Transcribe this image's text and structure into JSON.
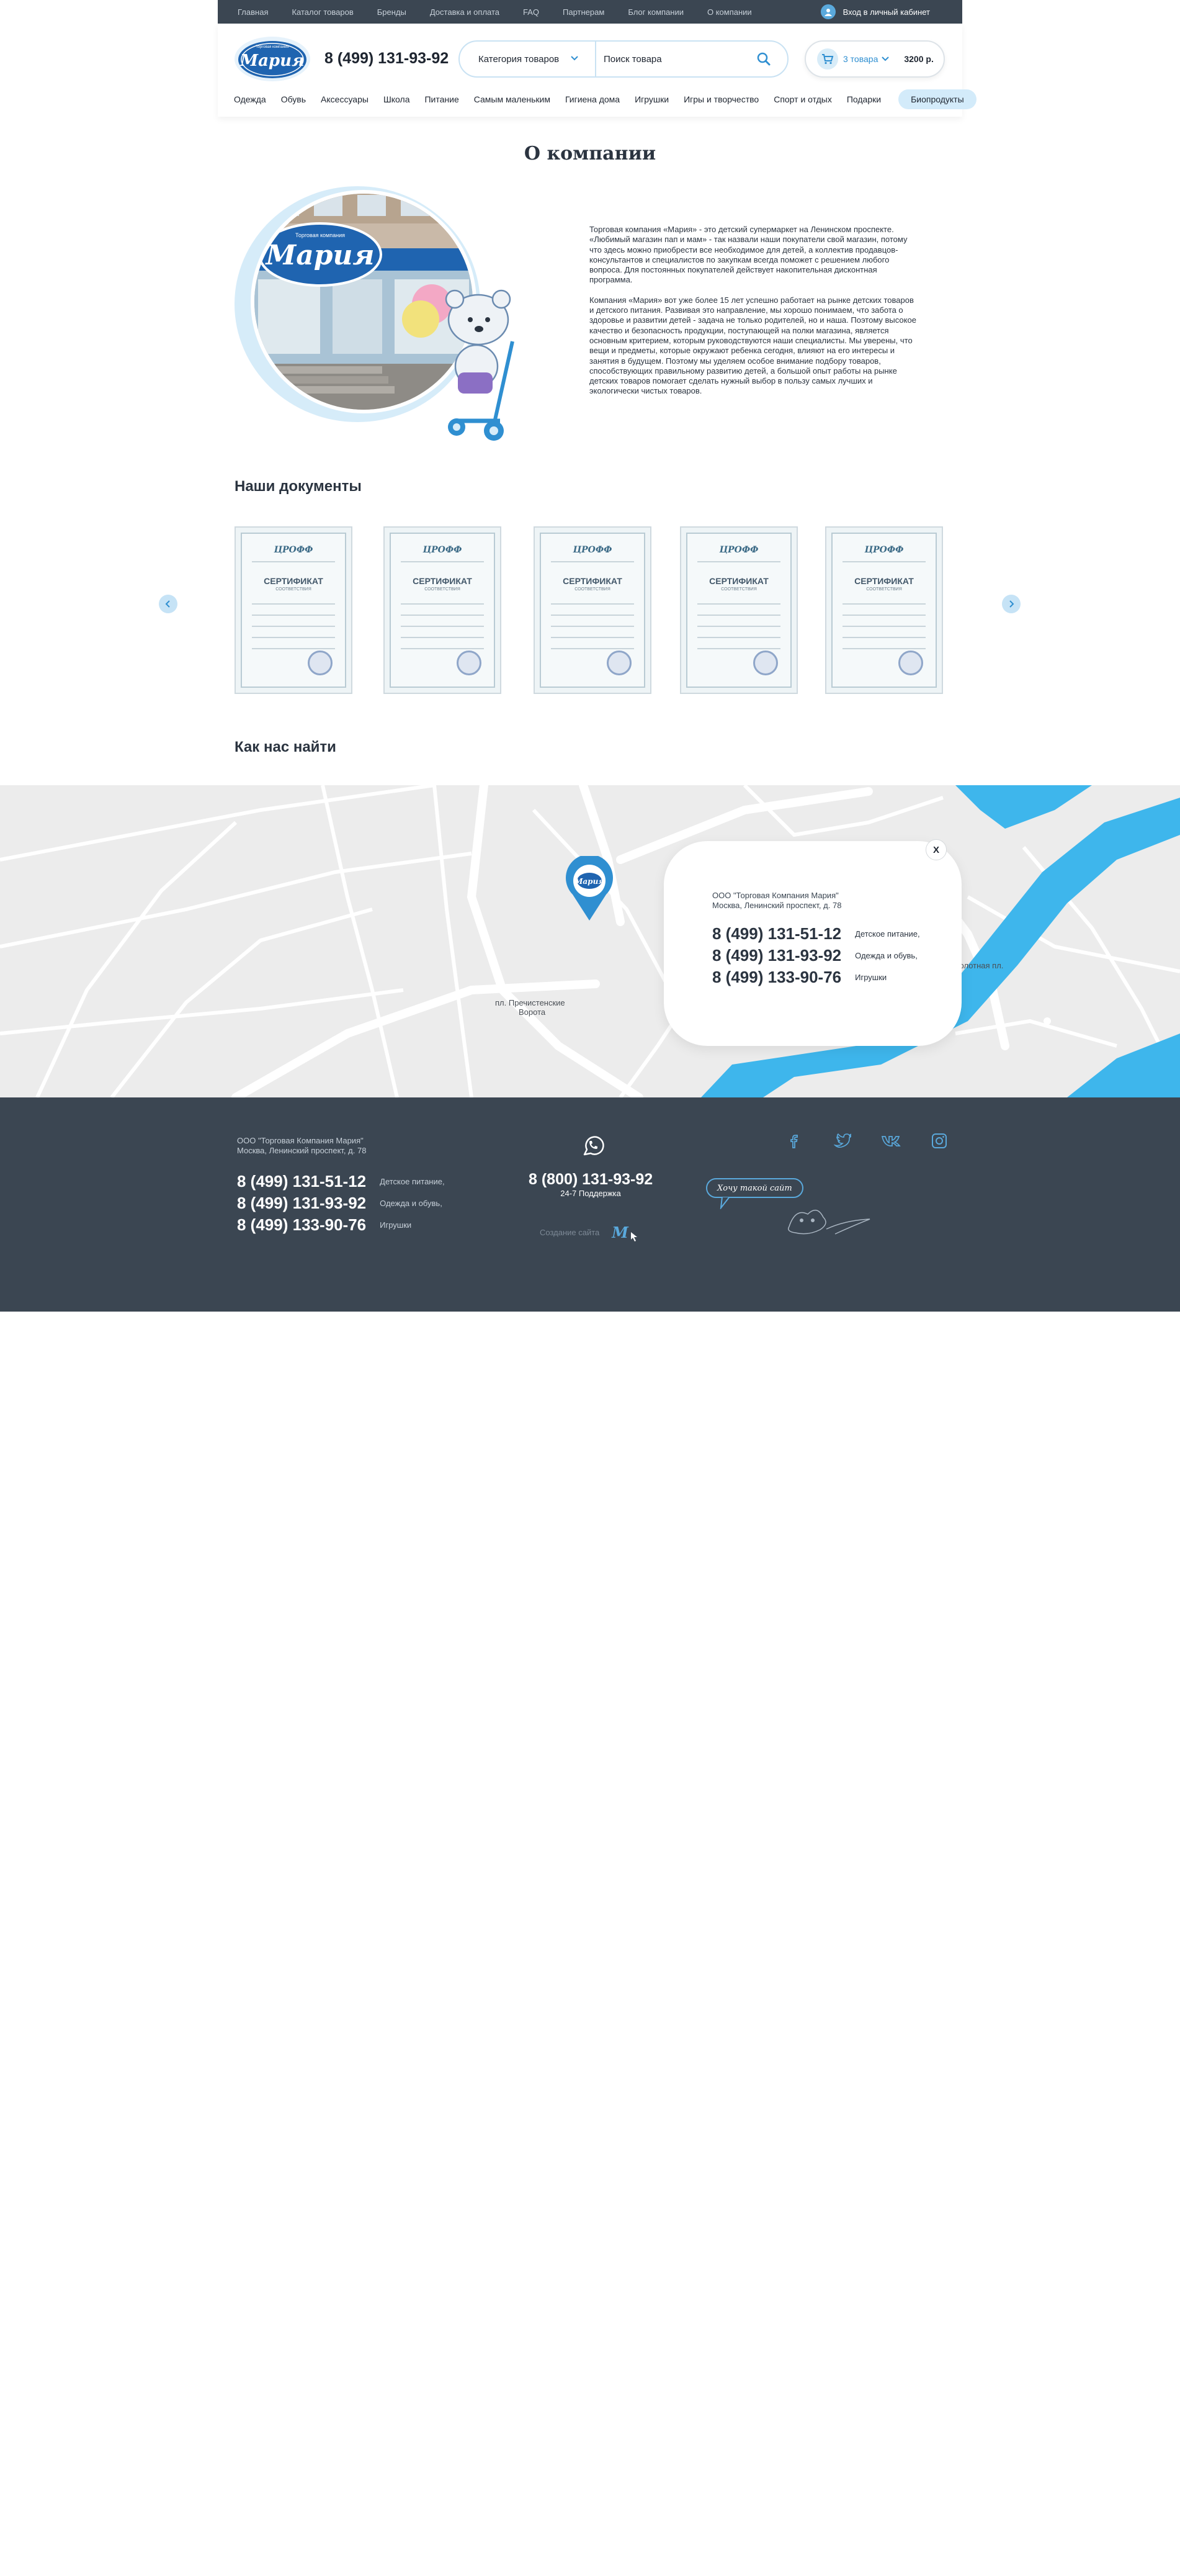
{
  "topbar": {
    "nav": [
      "Главная",
      "Каталог товаров",
      "Бренды",
      "Доставка и оплата",
      "FAQ",
      "Партнерам",
      "Блог компании",
      "О компании"
    ],
    "login_label": "Вход в личный кабинет"
  },
  "header": {
    "logo_text": "Мария",
    "logo_tagline": "Торговая компания",
    "phone": "8 (499) 131-93-92",
    "category_label": "Категория  товаров",
    "search_placeholder": "Поиск товара",
    "cart_count": "3 товара",
    "cart_total": "3200 р.",
    "categories": [
      "Одежда",
      "Обувь",
      "Аксессуары",
      "Школа",
      "Питание",
      "Самым маленьким",
      "Гигиена дома",
      "Игрушки",
      "Игры и творчество",
      "Спорт и отдых",
      "Подарки"
    ],
    "bio_label": "Биопродукты"
  },
  "about": {
    "title": "О компании",
    "store_sign": "Мария",
    "store_sign_top": "Торговая компания",
    "paragraphs": [
      "Торговая компания «Мария» - это детский супермаркет на Ленинском проспекте. «Любимый магазин пап и мам» - так назвали наши покупатели свой магазин, потому что здесь можно приобрести все необходимое для детей, а коллектив продавцов-консультантов и специалистов по закупкам всегда поможет с решением любого вопроса. Для постоянных покупателей действует накопительная дисконтная программа.",
      "Компания «Мария» вот уже более 15 лет успешно работает на рынке детских товаров и детского питания. Развивая это направление, мы хорошо понимаем, что забота о здоровье и развитии детей - задача не только родителей, но и наша. Поэтому высокое качество и безопасность продукции, поступающей на полки магазина, является основным критерием, которым руководствуются наши специалисты. Мы уверены, что вещи и предметы, которые окружают ребенка сегодня, влияют на его интересы и занятия в будущем. Поэтому мы уделяем особое внимание подбору товаров, способствующих правильному развитию детей, а большой опыт работы на рынке детских товаров помогает сделать нужный выбор в пользу самых лучших и экологически чистых товаров."
    ]
  },
  "documents": {
    "title": "Наши документы",
    "items": [
      {
        "org": "ЦРОФФ",
        "title": "СЕРТИФИКАТ",
        "subtitle": "СООТВЕТСТВИЯ"
      },
      {
        "org": "ЦРОФФ",
        "title": "СЕРТИФИКАТ",
        "subtitle": "СООТВЕТСТВИЯ"
      },
      {
        "org": "ЦРОФФ",
        "title": "СЕРТИФИКАТ",
        "subtitle": "СООТВЕТСТВИЯ"
      },
      {
        "org": "ЦРОФФ",
        "title": "СЕРТИФИКАТ",
        "subtitle": "СООТВЕТСТВИЯ"
      },
      {
        "org": "ЦРОФФ",
        "title": "СЕРТИФИКАТ",
        "subtitle": "СООТВЕТСТВИЯ"
      }
    ]
  },
  "find_us": {
    "title": "Как нас найти",
    "map_labels": [
      "пл. Пречистенские",
      "Ворота",
      "Болотная пл."
    ],
    "card": {
      "company": "ООО \"Торговая Компания Мария\"",
      "address": "Москва, Ленинский проспект, д. 78",
      "phones": [
        {
          "number": "8 (499) 131-51-12",
          "desc": "Детское питание,"
        },
        {
          "number": "8 (499) 131-93-92",
          "desc": "Одежда и обувь,"
        },
        {
          "number": "8 (499) 133-90-76",
          "desc": "Игрушки"
        }
      ],
      "close_label": "X"
    }
  },
  "footer": {
    "company": "ООО \"Торговая Компания Мария\"",
    "address": "Москва, Ленинский проспект, д. 78",
    "phones": [
      {
        "number": "8 (499) 131-51-12",
        "desc": "Детское питание,"
      },
      {
        "number": "8 (499) 131-93-92",
        "desc": "Одежда и обувь,"
      },
      {
        "number": "8 (499) 133-90-76",
        "desc": "Игрушки"
      }
    ],
    "support_phone": "8 (800) 131-93-92",
    "support_label": "24-7 Поддержка",
    "made_by_label": "Создание сайта",
    "made_by_logo": "M",
    "want_site_label": "Хочу такой сайт",
    "socials": [
      "facebook-icon",
      "twitter-icon",
      "vk-icon",
      "instagram-icon"
    ]
  },
  "colors": {
    "accent": "#2f8fd1",
    "dark": "#3b4652",
    "water": "#3eb6ec",
    "map_bg": "#ececec"
  }
}
